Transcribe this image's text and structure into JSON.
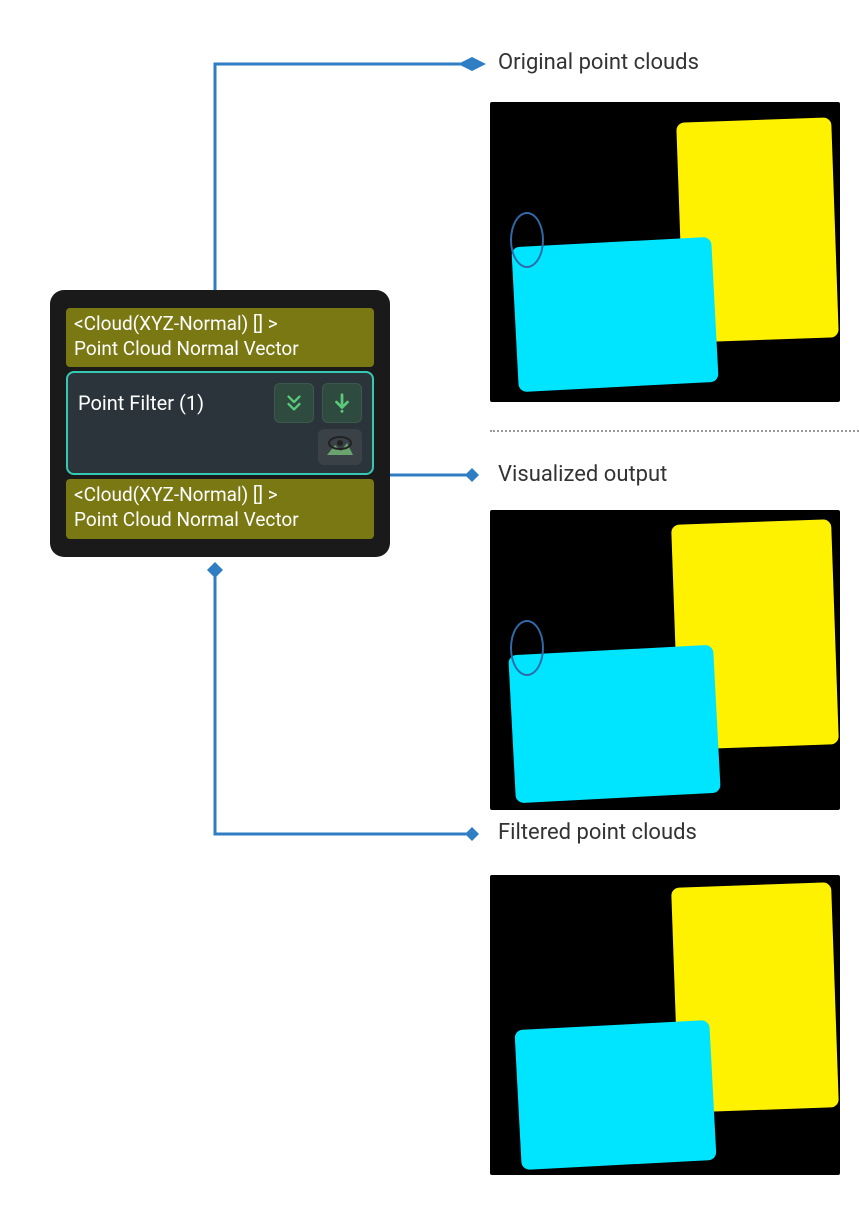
{
  "node": {
    "input_port": {
      "line1": "<Cloud(XYZ-Normal) [] >",
      "line2": "Point Cloud Normal Vector"
    },
    "center": {
      "title": "Point Filter (1)",
      "icon1_name": "expand-down-icon",
      "icon2_name": "download-icon",
      "visual_icon_name": "eye-view-icon"
    },
    "output_port": {
      "line1": "<Cloud(XYZ-Normal) [] >",
      "line2": "Point Cloud Normal Vector"
    }
  },
  "labels": {
    "original": "Original point clouds",
    "visualized": "Visualized output",
    "filtered": "Filtered point clouds"
  }
}
